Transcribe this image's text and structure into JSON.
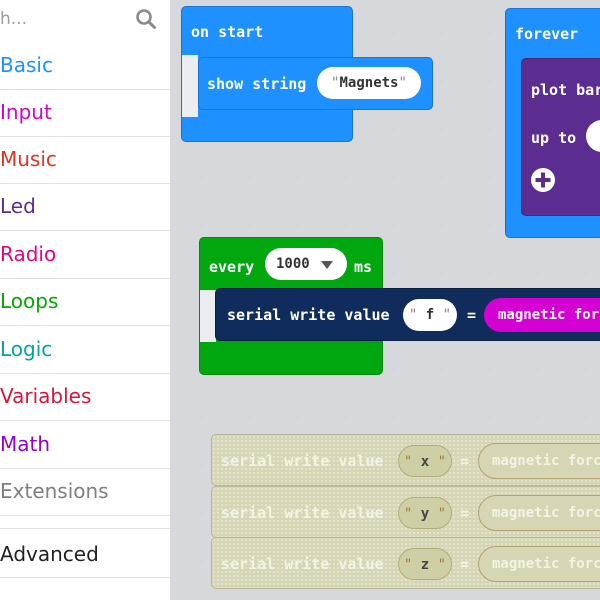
{
  "search": {
    "placeholder": "h..."
  },
  "categories": [
    {
      "label": "Basic",
      "color": "#1e90ff"
    },
    {
      "label": "Input",
      "color": "#d400d4"
    },
    {
      "label": "Music",
      "color": "#e63022"
    },
    {
      "label": "Led",
      "color": "#5c2d91"
    },
    {
      "label": "Radio",
      "color": "#e3008c"
    },
    {
      "label": "Loops",
      "color": "#00aa00"
    },
    {
      "label": "Logic",
      "color": "#00a4a6"
    },
    {
      "label": "Variables",
      "color": "#dc143c"
    },
    {
      "label": "Math",
      "color": "#9400d3"
    },
    {
      "label": "Extensions",
      "color": "#7f7f7f"
    },
    {
      "label": "Advanced",
      "color": "#222222"
    }
  ],
  "blocks": {
    "on_start": {
      "label": "on start"
    },
    "show_string": {
      "label": "show string",
      "value": "Magnets"
    },
    "forever": {
      "label": "forever"
    },
    "plot_bar": {
      "label1": "plot bar",
      "label2": "up to"
    },
    "every": {
      "label": "every",
      "interval": "1000",
      "unit": "ms"
    },
    "serial_write_f": {
      "label": "serial write value",
      "name": "f",
      "equals": "=",
      "reporter": "magnetic force"
    },
    "disabled_serial_writes": [
      {
        "label": "serial write value",
        "name": "x",
        "equals": "=",
        "reporter": "magnetic force"
      },
      {
        "label": "serial write value",
        "name": "y",
        "equals": "=",
        "reporter": "magnetic force"
      },
      {
        "label": "serial write value",
        "name": "z",
        "equals": "=",
        "reporter": "magnetic force"
      }
    ],
    "quote": "\""
  }
}
